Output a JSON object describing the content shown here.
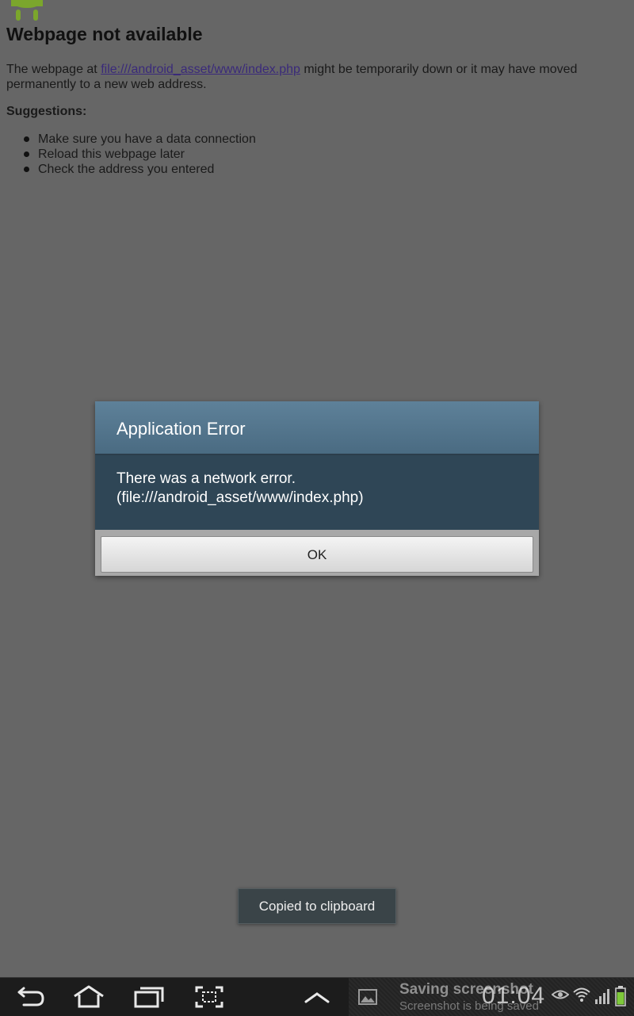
{
  "webpage": {
    "title": "Webpage not available",
    "desc_prefix": "The webpage at ",
    "link": "file:///android_asset/www/index.php",
    "desc_suffix": " might be temporarily down or it may have moved permanently to a new web address.",
    "suggestions_title": "Suggestions:",
    "suggestions": [
      "Make sure you have a data connection",
      "Reload this webpage later",
      "Check the address you entered"
    ]
  },
  "dialog": {
    "title": "Application Error",
    "message": "There was a network error. (file:///android_asset/www/index.php)",
    "ok_label": "OK"
  },
  "toast": {
    "text": "Copied to clipboard"
  },
  "status_bar": {
    "notification_title": "Saving screenshot",
    "notification_subtitle": "Screenshot is being saved",
    "time": "01:04"
  },
  "icons": {
    "page": "android-robot-icon",
    "nav": [
      "back-icon",
      "home-icon",
      "recent-apps-icon",
      "screenshot-icon",
      "menu-up-icon"
    ],
    "status": [
      "gallery-icon",
      "eye-icon",
      "wifi-icon",
      "signal-icon",
      "battery-icon"
    ]
  },
  "colors": {
    "background": "#666666",
    "dialog_header": "#5e8199",
    "dialog_body": "#2f4656",
    "battery": "#7ec93a"
  }
}
